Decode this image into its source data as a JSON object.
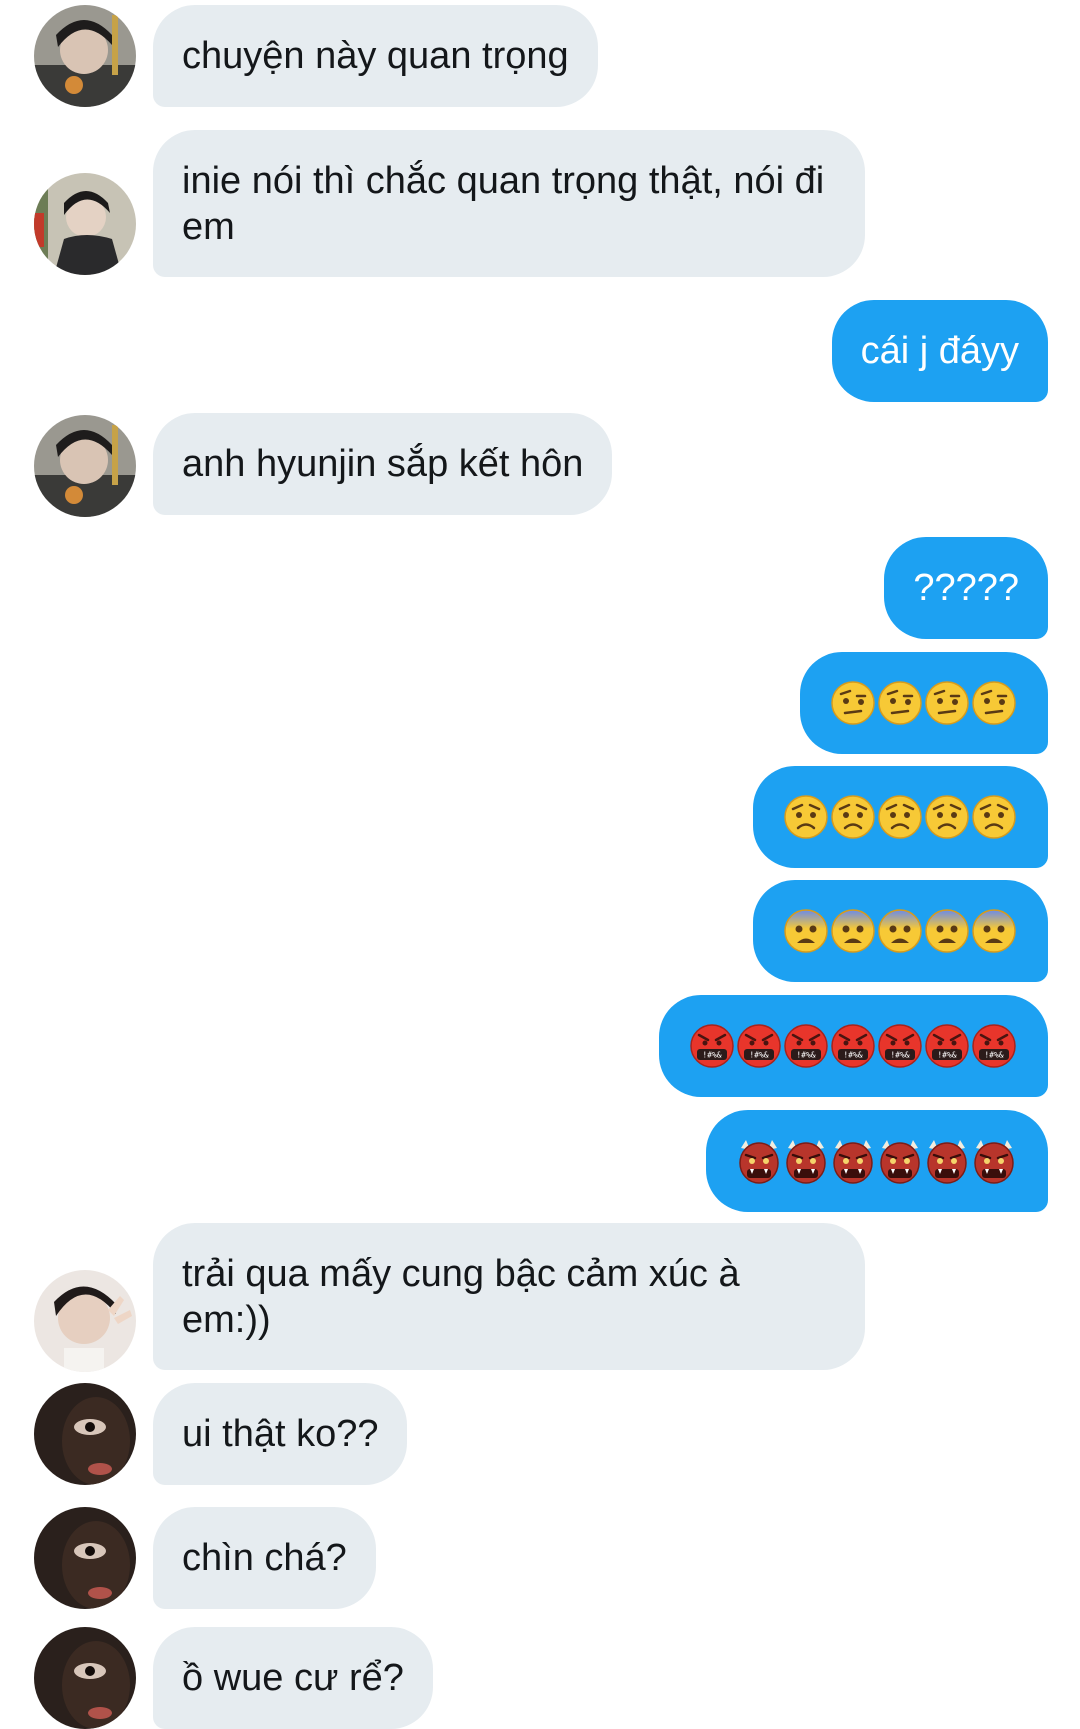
{
  "messages": [
    {
      "id": "m1",
      "side": "incoming",
      "avatar": "avatar-a",
      "text": "chuyện này quan trọng"
    },
    {
      "id": "m2",
      "side": "incoming",
      "avatar": "avatar-b",
      "text": "inie nói thì chắc quan trọng thật, nói đi em"
    },
    {
      "id": "m3",
      "side": "outgoing",
      "text": "cái j đáyy"
    },
    {
      "id": "m4",
      "side": "incoming",
      "avatar": "avatar-a",
      "text": "anh hyunjin sắp kết hôn"
    },
    {
      "id": "m5",
      "side": "outgoing",
      "text": "?????"
    },
    {
      "id": "m6",
      "side": "outgoing",
      "emoji": "raised-eyebrow-face",
      "count": 4
    },
    {
      "id": "m7",
      "side": "outgoing",
      "emoji": "worried-face",
      "count": 5
    },
    {
      "id": "m8",
      "side": "outgoing",
      "emoji": "anxious-face",
      "count": 5
    },
    {
      "id": "m9",
      "side": "outgoing",
      "emoji": "face-with-symbols-on-mouth",
      "count": 7
    },
    {
      "id": "m10",
      "side": "outgoing",
      "emoji": "ogre",
      "count": 6
    },
    {
      "id": "m11",
      "side": "incoming",
      "avatar": "avatar-c",
      "text": "trải qua mấy cung bậc cảm xúc à em:))"
    },
    {
      "id": "m12",
      "side": "incoming",
      "avatar": "avatar-d",
      "text": "ui thật ko??"
    },
    {
      "id": "m13",
      "side": "incoming",
      "avatar": "avatar-d",
      "text": "chìn chá?"
    },
    {
      "id": "m14",
      "side": "incoming",
      "avatar": "avatar-d",
      "text": "ồ wue cư rể?"
    }
  ],
  "colors": {
    "incoming_bubble": "#e6ecf0",
    "incoming_text": "#14171a",
    "outgoing_bubble": "#1da1f2",
    "outgoing_text": "#ffffff"
  }
}
